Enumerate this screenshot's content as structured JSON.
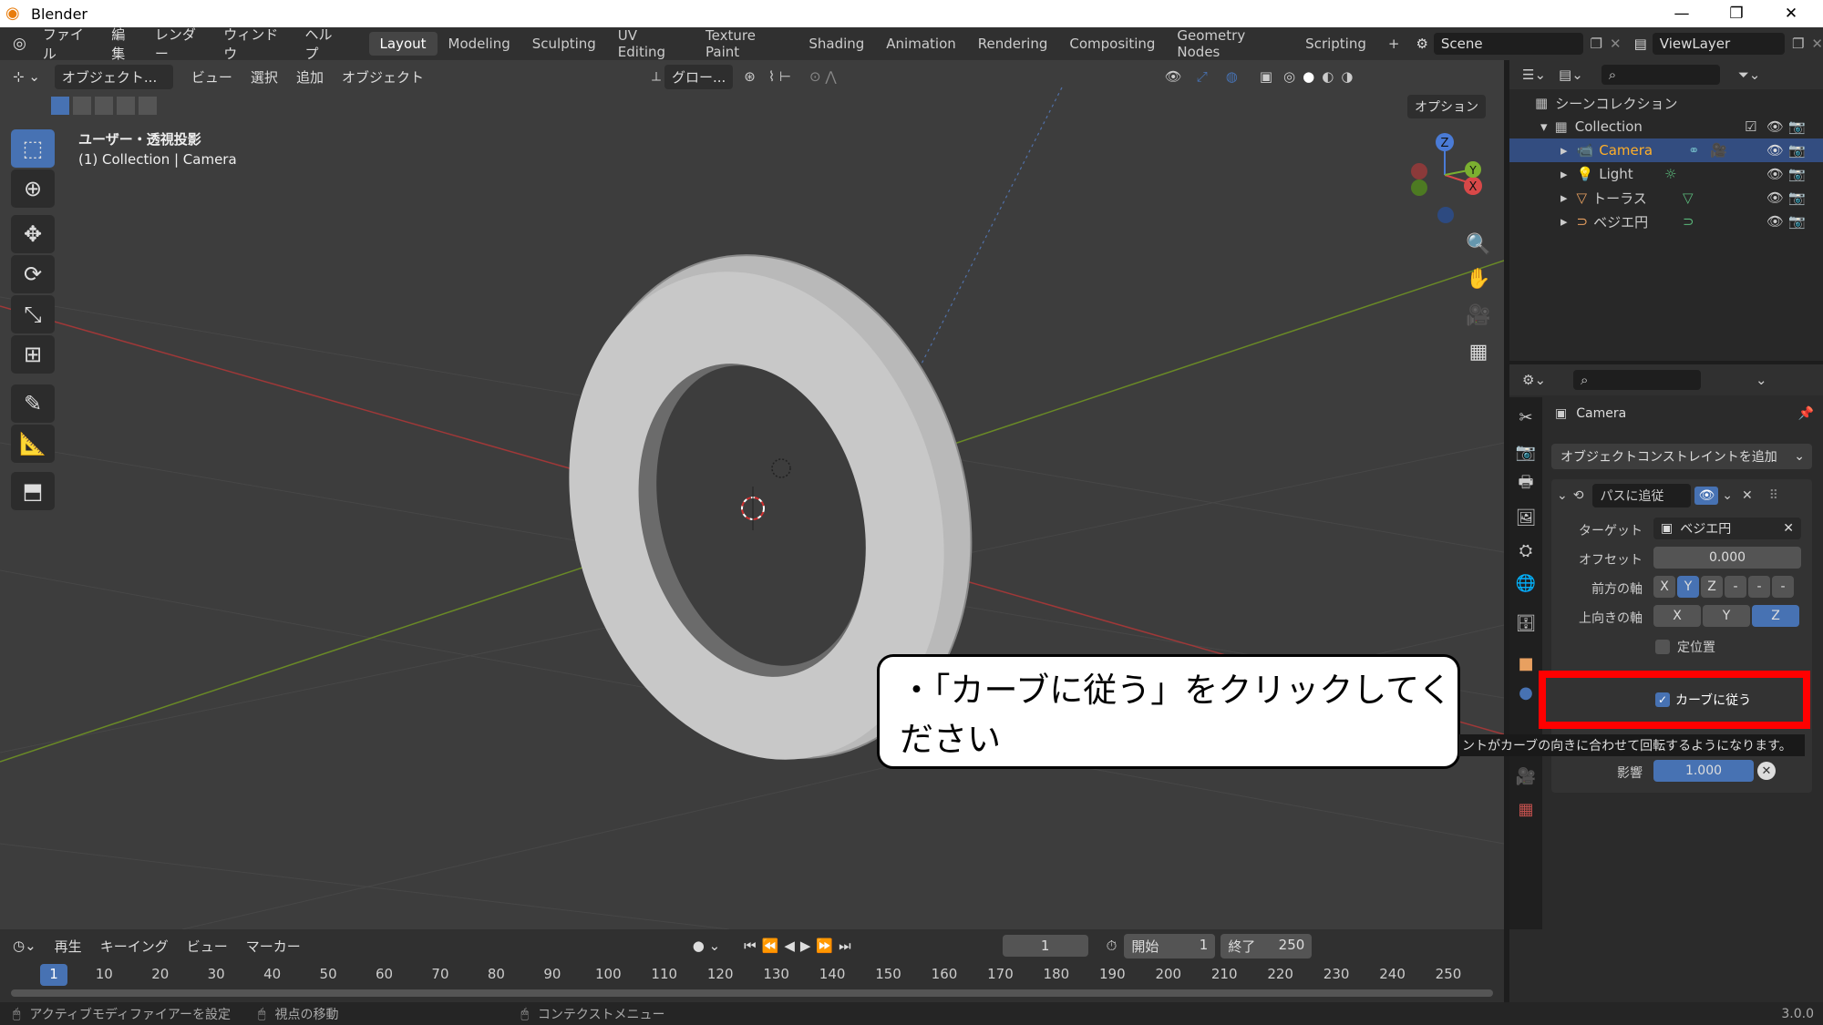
{
  "app": {
    "title": "Blender",
    "version": "3.0.0"
  },
  "menu": [
    "ファイル",
    "編集",
    "レンダー",
    "ウィンドウ",
    "ヘルプ"
  ],
  "workspaces": [
    "Layout",
    "Modeling",
    "Sculpting",
    "UV Editing",
    "Texture Paint",
    "Shading",
    "Animation",
    "Rendering",
    "Compositing",
    "Geometry Nodes",
    "Scripting"
  ],
  "active_workspace": "Layout",
  "scene": "Scene",
  "view_layer": "ViewLayer",
  "viewport": {
    "mode": "オブジェクト...",
    "menus": [
      "ビュー",
      "選択",
      "追加",
      "オブジェクト"
    ],
    "transform": "グロー...",
    "options": "オプション",
    "view_name": "ユーザー・透視投影",
    "collection_info": "(1) Collection | Camera"
  },
  "outliner": {
    "root": "シーンコレクション",
    "collection": "Collection",
    "items": [
      "Camera",
      "Light",
      "トーラス",
      "ベジエ円"
    ]
  },
  "properties": {
    "object_name": "Camera",
    "add_constraint": "オブジェクトコンストレイントを追加",
    "constraint_name": "パスに追従",
    "target_label": "ターゲット",
    "target_value": "ベジエ円",
    "offset_label": "オフセット",
    "offset_value": "0.000",
    "forward_label": "前方の軸",
    "forward_options": [
      "X",
      "Y",
      "Z",
      "-",
      "-",
      "-"
    ],
    "up_label": "上向きの軸",
    "up_options": [
      "X",
      "Y",
      "Z"
    ],
    "fixed_position": "定位置",
    "follow_curve": "カーブに従う",
    "tooltip": "ントがカーブの向きに合わせて回転するようになります。",
    "influence_label": "影響",
    "influence_value": "1.000"
  },
  "callout": "・「カーブに従う」をクリックしてください",
  "timeline": {
    "menus": [
      "再生",
      "キーイング",
      "ビュー",
      "マーカー"
    ],
    "current_frame": "1",
    "start_label": "開始",
    "start_value": "1",
    "end_label": "終了",
    "end_value": "250",
    "ticks": [
      "1",
      "10",
      "20",
      "30",
      "40",
      "50",
      "60",
      "70",
      "80",
      "90",
      "100",
      "110",
      "120",
      "130",
      "140",
      "150",
      "160",
      "170",
      "180",
      "190",
      "200",
      "210",
      "220",
      "230",
      "240",
      "250"
    ]
  },
  "status": {
    "left": "アクティブモディファイアーを設定",
    "middle": "視点の移動",
    "right": "コンテクストメニュー"
  },
  "colors": {
    "highlight": "#ff0000",
    "accent": "#4772b3",
    "selected_text": "#ffaf29"
  }
}
